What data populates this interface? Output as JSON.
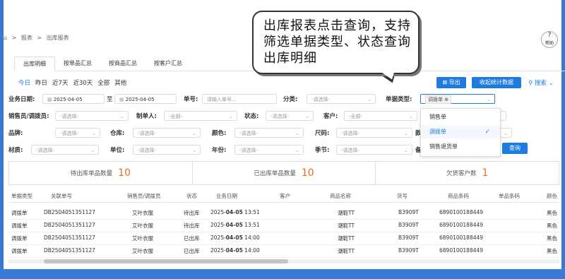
{
  "breadcrumb": {
    "home_icon": "home-icon",
    "items": [
      "报表",
      "出库报表"
    ]
  },
  "help": {
    "label": "帮助",
    "icon": "question-icon"
  },
  "tabs": [
    {
      "label": "出库明细",
      "active": true
    },
    {
      "label": "按单品汇总",
      "active": false
    },
    {
      "label": "按商品汇总",
      "active": false
    },
    {
      "label": "按客户汇总",
      "active": false
    }
  ],
  "quick_dates": [
    "今日",
    "昨日",
    "近7天",
    "近30天",
    "全部",
    "其他"
  ],
  "toolbar": {
    "export_label": "导出",
    "stats_label": "收起统计数据",
    "more_search_label": "搜索"
  },
  "filters": {
    "biz_date_label": "业务日期:",
    "date_from": "2025-04-05",
    "date_to_sep": "至",
    "date_to": "2025-04-05",
    "doc_no_label": "单号:",
    "doc_no_placeholder": "请输入单号...",
    "category_label": "分类:",
    "category_value": "-请选择-",
    "doc_type_label": "单据类型:",
    "doc_type_tag": "调拨单",
    "salesperson_label": "销售员/调拨员:",
    "salesperson_value": "-请选择-",
    "maker_label": "制单人:",
    "maker_value": "-全部-",
    "status_label": "状态:",
    "status_value": "-请选择-",
    "customer_label": "客户:",
    "customer_value": "-全部-",
    "brand_label": "品牌:",
    "brand_value": "-请选择-",
    "warehouse_label": "仓库:",
    "warehouse_value": "-请选择-",
    "color_label": "颜色:",
    "color_value": "-请选择-",
    "size_label": "尺码:",
    "size_value": "-请选择-",
    "size2_label": "款",
    "material_label": "材质:",
    "material_value": "-请选择-",
    "unit_label": "单位:",
    "unit_value": "-请选择-",
    "year_label": "年份:",
    "year_value": "-请选择-",
    "season_label": "季节:",
    "season_value": "-请选择-",
    "other_label": "备",
    "query_button": "查询"
  },
  "doc_type_options": [
    {
      "label": "销售单",
      "selected": false
    },
    {
      "label": "调拨单",
      "selected": true
    },
    {
      "label": "销售退货单",
      "selected": false
    }
  ],
  "summary": [
    {
      "label": "待出库单品数量",
      "value": "10"
    },
    {
      "label": "已出库单品数量",
      "value": "10"
    },
    {
      "label": "欠货客户数",
      "value": "1"
    }
  ],
  "table": {
    "headers": [
      "单据类型",
      "关联单号",
      "销售员/调拨员",
      "状态",
      "业务日期",
      "客户",
      "商品名称",
      "货号",
      "商品条码",
      "单品条码",
      "颜色"
    ],
    "rows": [
      [
        "调拨单",
        "DB2504051351127",
        "艾叶衣服",
        "待出库",
        "2025-04-05 13:51",
        "",
        "潮鞋TT",
        "B3909T",
        "6890100188449",
        "",
        "黑色"
      ],
      [
        "调拨单",
        "DB2504051351127",
        "艾叶衣服",
        "待出库",
        "2025-04-05 13:51",
        "",
        "潮鞋TT",
        "B3909T",
        "6890100188449",
        "",
        "黑色"
      ],
      [
        "调拨单",
        "DB2504051351127",
        "艾叶衣服",
        "已出库",
        "2025-04-05 14:00",
        "",
        "潮鞋TT",
        "B3909T",
        "6890100188449",
        "",
        "黑色"
      ],
      [
        "调拨单",
        "DB2504051351127",
        "艾叶衣服",
        "已出库",
        "2025-04-05 14:00",
        "",
        "潮鞋TT",
        "B3909T",
        "6890100188449",
        "",
        "黑色"
      ]
    ]
  },
  "callout": {
    "text": "出库报表点击查询，支持筛选单据类型、状态查询出库明细"
  },
  "colors": {
    "accent": "#1e7be0",
    "frame": "#3a7ad6",
    "highlight": "#f26a1b"
  }
}
